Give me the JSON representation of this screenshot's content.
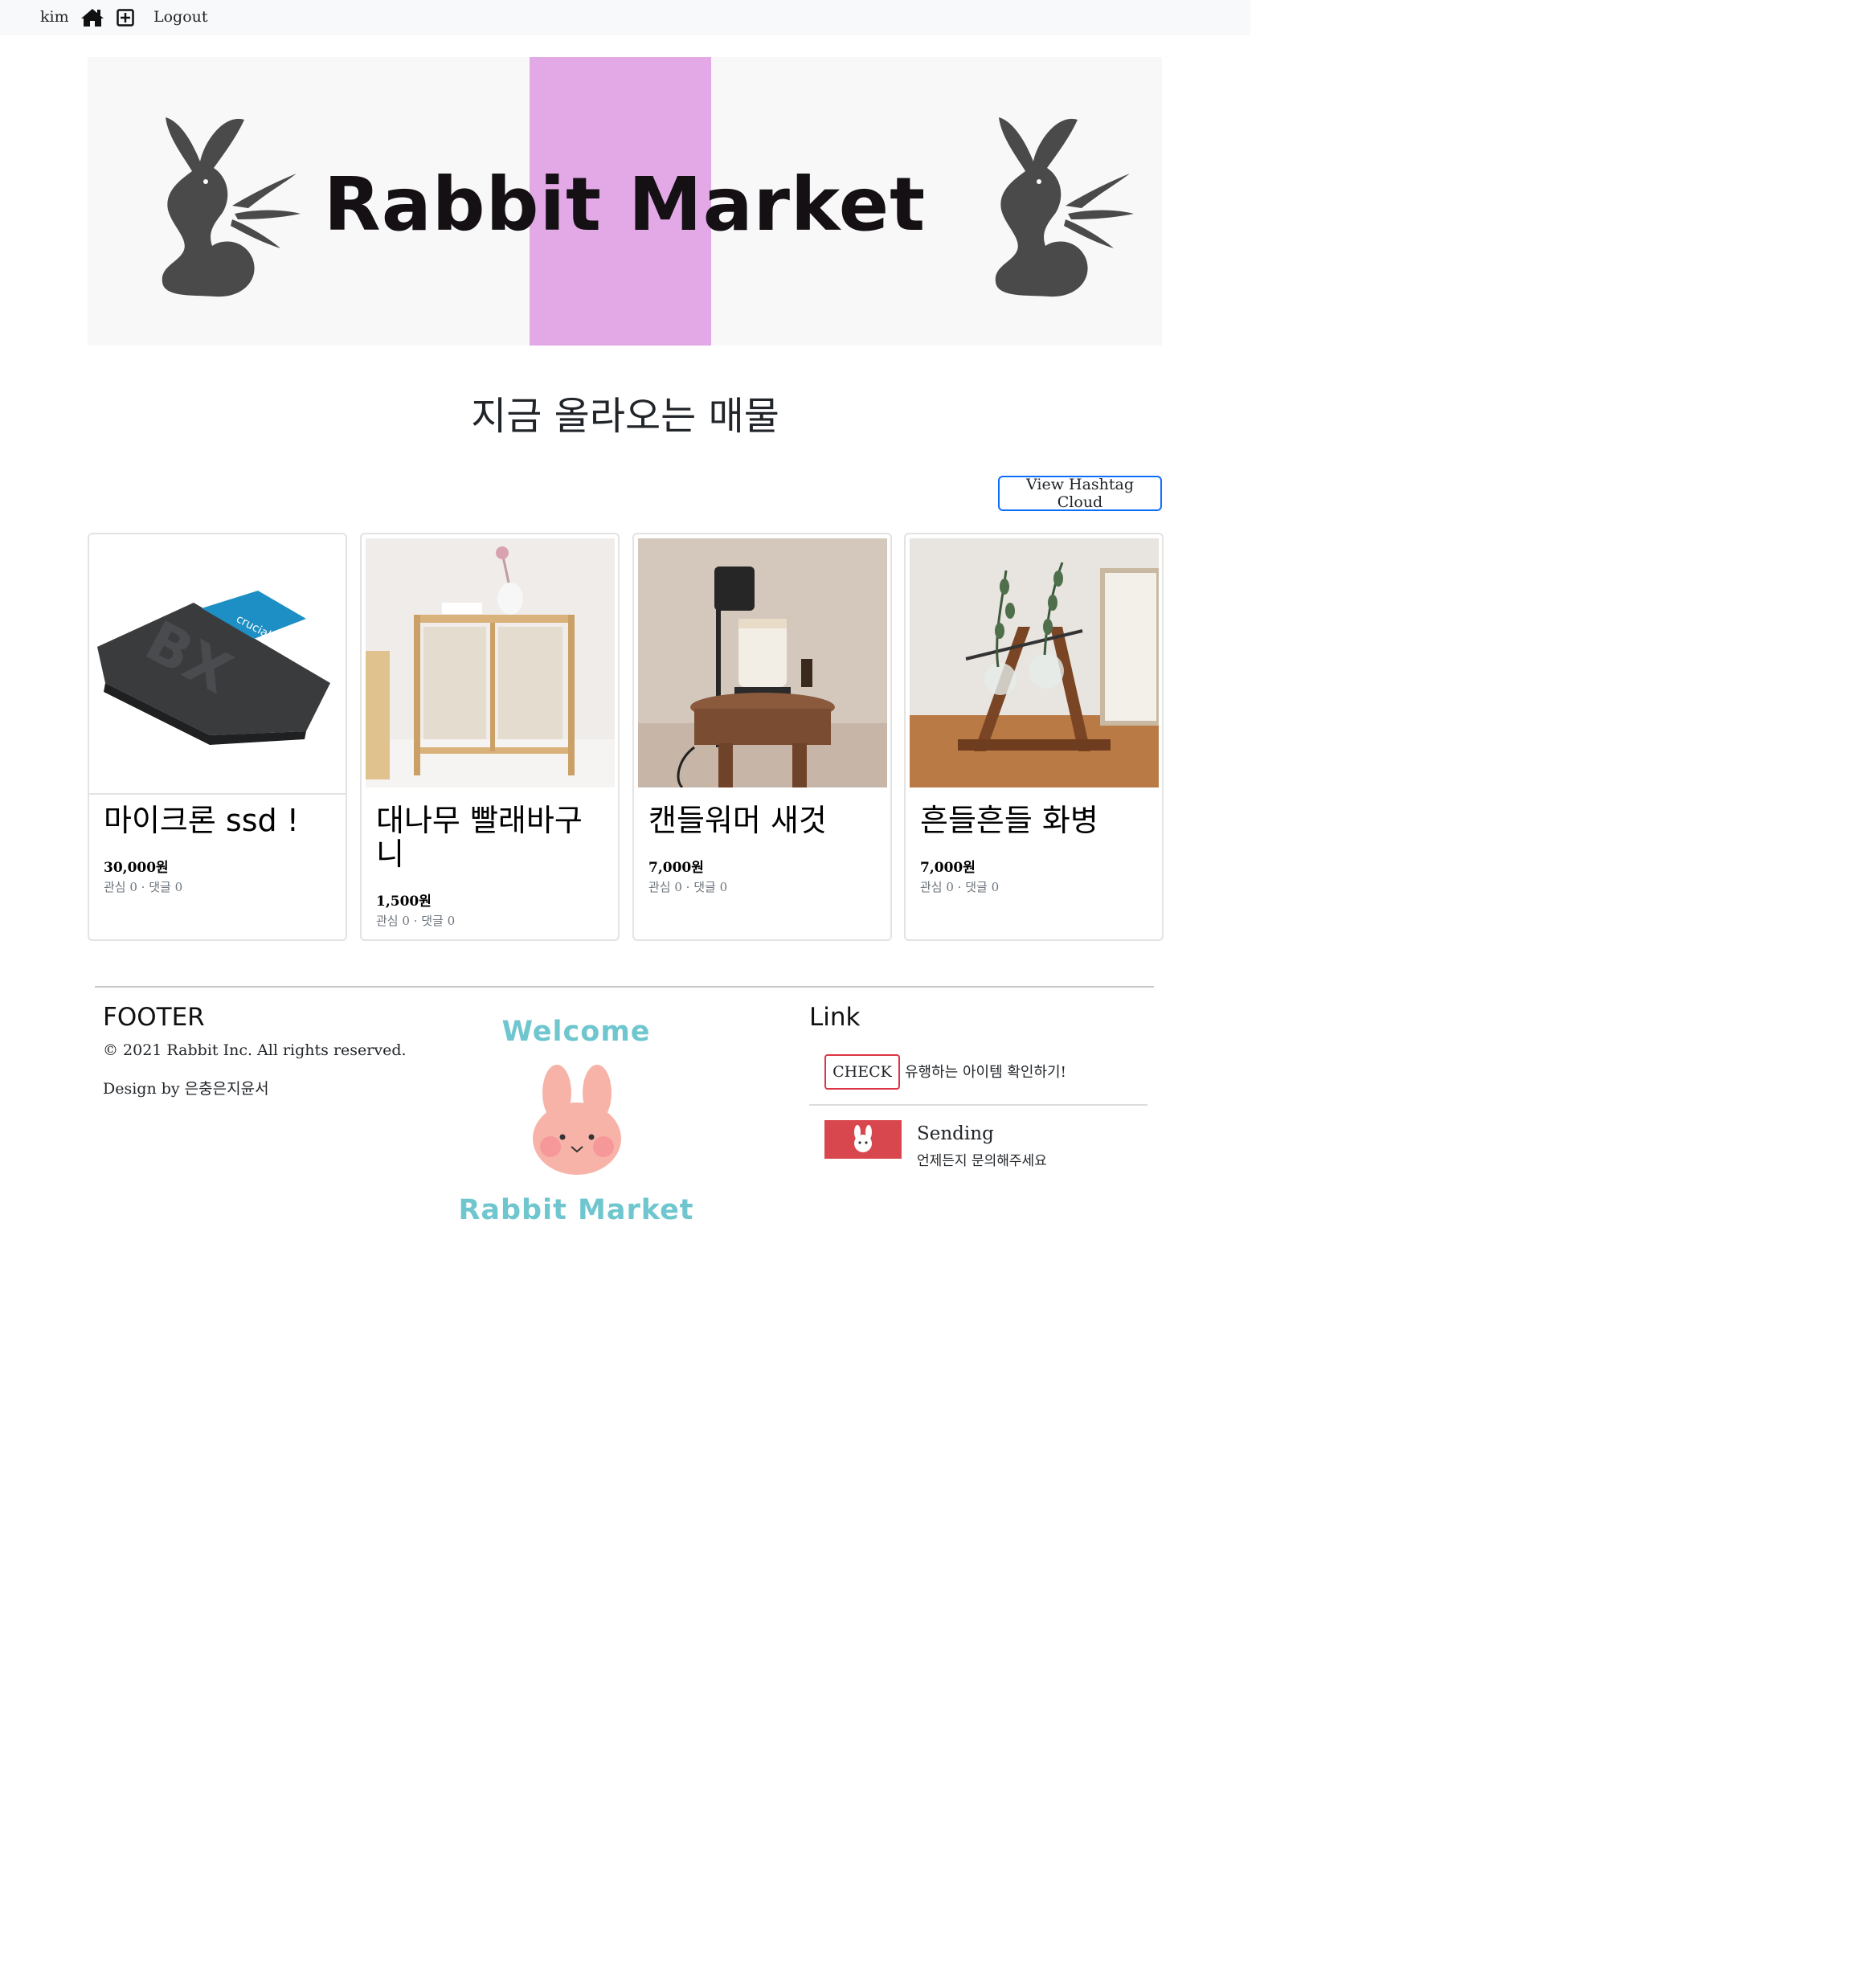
{
  "nav": {
    "user": "kim",
    "home_icon": "home-icon",
    "add_icon": "plus-square-icon",
    "logout": "Logout"
  },
  "banner": {
    "title": "Rabbit Market",
    "stripe_color": "#e3a8e6",
    "logo_icon": "rabbit-with-carrot-icon"
  },
  "section": {
    "title": "지금 올라오는 매물",
    "hashtag_button": "View Hashtag Cloud"
  },
  "products": [
    {
      "title": "마이크론 ssd !",
      "price": "30,000원",
      "meta": "관심 0 · 댓글 0",
      "image": "ssd-drive-photo"
    },
    {
      "title": "대나무 빨래바구니",
      "price": "1,500원",
      "meta": "관심 0 · 댓글 0",
      "image": "bamboo-laundry-basket-photo"
    },
    {
      "title": "캔들워머 새것",
      "price": "7,000원",
      "meta": "관심 0 · 댓글 0",
      "image": "candle-warmer-photo"
    },
    {
      "title": "흔들흔들 화병",
      "price": "7,000원",
      "meta": "관심 0 · 댓글 0",
      "image": "swing-vase-photo"
    }
  ],
  "footer": {
    "heading": "FOOTER",
    "copyright": "© 2021 Rabbit Inc. All rights reserved.",
    "design": "Design by 은충은지윤서",
    "welcome": "Welcome",
    "brand": "Rabbit Market",
    "link_heading": "Link",
    "check_button": "CHECK",
    "check_text": "유행하는 아이템 확인하기!",
    "sending_title": "Sending",
    "sending_sub": "언제든지 문의해주세요",
    "colors": {
      "accent_teal": "#6fc6cf",
      "check_red": "#dc3545",
      "sending_red": "#d9474e",
      "primary_blue": "#0d6efd"
    }
  }
}
